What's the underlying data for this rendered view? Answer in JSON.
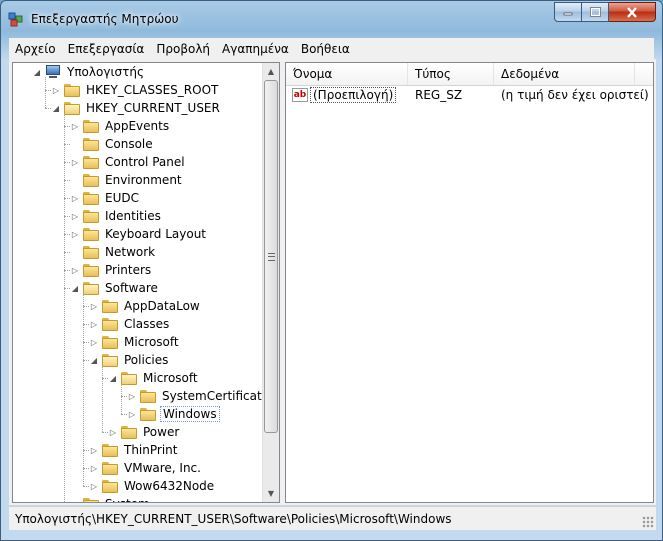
{
  "window": {
    "title": "Επεξεργαστής Μητρώου"
  },
  "menu": [
    "Αρχείο",
    "Επεξεργασία",
    "Προβολή",
    "Αγαπημένα",
    "Βοήθεια"
  ],
  "tree": [
    {
      "label": "Υπολογιστής",
      "depth": 0,
      "expander": "expanded",
      "icon": "computer-icon"
    },
    {
      "label": "HKEY_CLASSES_ROOT",
      "depth": 1,
      "expander": "collapsed",
      "icon": "folder-icon"
    },
    {
      "label": "HKEY_CURRENT_USER",
      "depth": 1,
      "expander": "expanded",
      "icon": "folder-icon"
    },
    {
      "label": "AppEvents",
      "depth": 2,
      "expander": "collapsed",
      "icon": "folder-icon"
    },
    {
      "label": "Console",
      "depth": 2,
      "expander": "none",
      "icon": "folder-icon"
    },
    {
      "label": "Control Panel",
      "depth": 2,
      "expander": "collapsed",
      "icon": "folder-icon"
    },
    {
      "label": "Environment",
      "depth": 2,
      "expander": "none",
      "icon": "folder-icon"
    },
    {
      "label": "EUDC",
      "depth": 2,
      "expander": "collapsed",
      "icon": "folder-icon"
    },
    {
      "label": "Identities",
      "depth": 2,
      "expander": "collapsed",
      "icon": "folder-icon"
    },
    {
      "label": "Keyboard Layout",
      "depth": 2,
      "expander": "collapsed",
      "icon": "folder-icon"
    },
    {
      "label": "Network",
      "depth": 2,
      "expander": "none",
      "icon": "folder-icon"
    },
    {
      "label": "Printers",
      "depth": 2,
      "expander": "collapsed",
      "icon": "folder-icon"
    },
    {
      "label": "Software",
      "depth": 2,
      "expander": "expanded",
      "icon": "folder-icon"
    },
    {
      "label": "AppDataLow",
      "depth": 3,
      "expander": "collapsed",
      "icon": "folder-icon"
    },
    {
      "label": "Classes",
      "depth": 3,
      "expander": "collapsed",
      "icon": "folder-icon"
    },
    {
      "label": "Microsoft",
      "depth": 3,
      "expander": "collapsed",
      "icon": "folder-icon"
    },
    {
      "label": "Policies",
      "depth": 3,
      "expander": "expanded",
      "icon": "folder-icon"
    },
    {
      "label": "Microsoft",
      "depth": 4,
      "expander": "expanded",
      "icon": "folder-icon"
    },
    {
      "label": "SystemCertificates",
      "depth": 5,
      "expander": "collapsed",
      "icon": "folder-icon"
    },
    {
      "label": "Windows",
      "depth": 5,
      "expander": "collapsed",
      "icon": "folder-icon",
      "selected": true
    },
    {
      "label": "Power",
      "depth": 4,
      "expander": "collapsed",
      "icon": "folder-icon"
    },
    {
      "label": "ThinPrint",
      "depth": 3,
      "expander": "collapsed",
      "icon": "folder-icon"
    },
    {
      "label": "VMware, Inc.",
      "depth": 3,
      "expander": "collapsed",
      "icon": "folder-icon"
    },
    {
      "label": "Wow6432Node",
      "depth": 3,
      "expander": "collapsed",
      "icon": "folder-icon"
    },
    {
      "label": "System",
      "depth": 2,
      "expander": "collapsed",
      "icon": "folder-icon"
    }
  ],
  "list": {
    "columns": [
      "Όνομα",
      "Τύπος",
      "Δεδομένα"
    ],
    "rows": [
      {
        "name": "(Προεπιλογή)",
        "type": "REG_SZ",
        "data": "(η τιμή δεν έχει οριστεί)",
        "icon": "string-value-icon",
        "icon_text": "ab"
      }
    ]
  },
  "status": {
    "path": "Υπολογιστής\\HKEY_CURRENT_USER\\Software\\Policies\\Microsoft\\Windows"
  }
}
